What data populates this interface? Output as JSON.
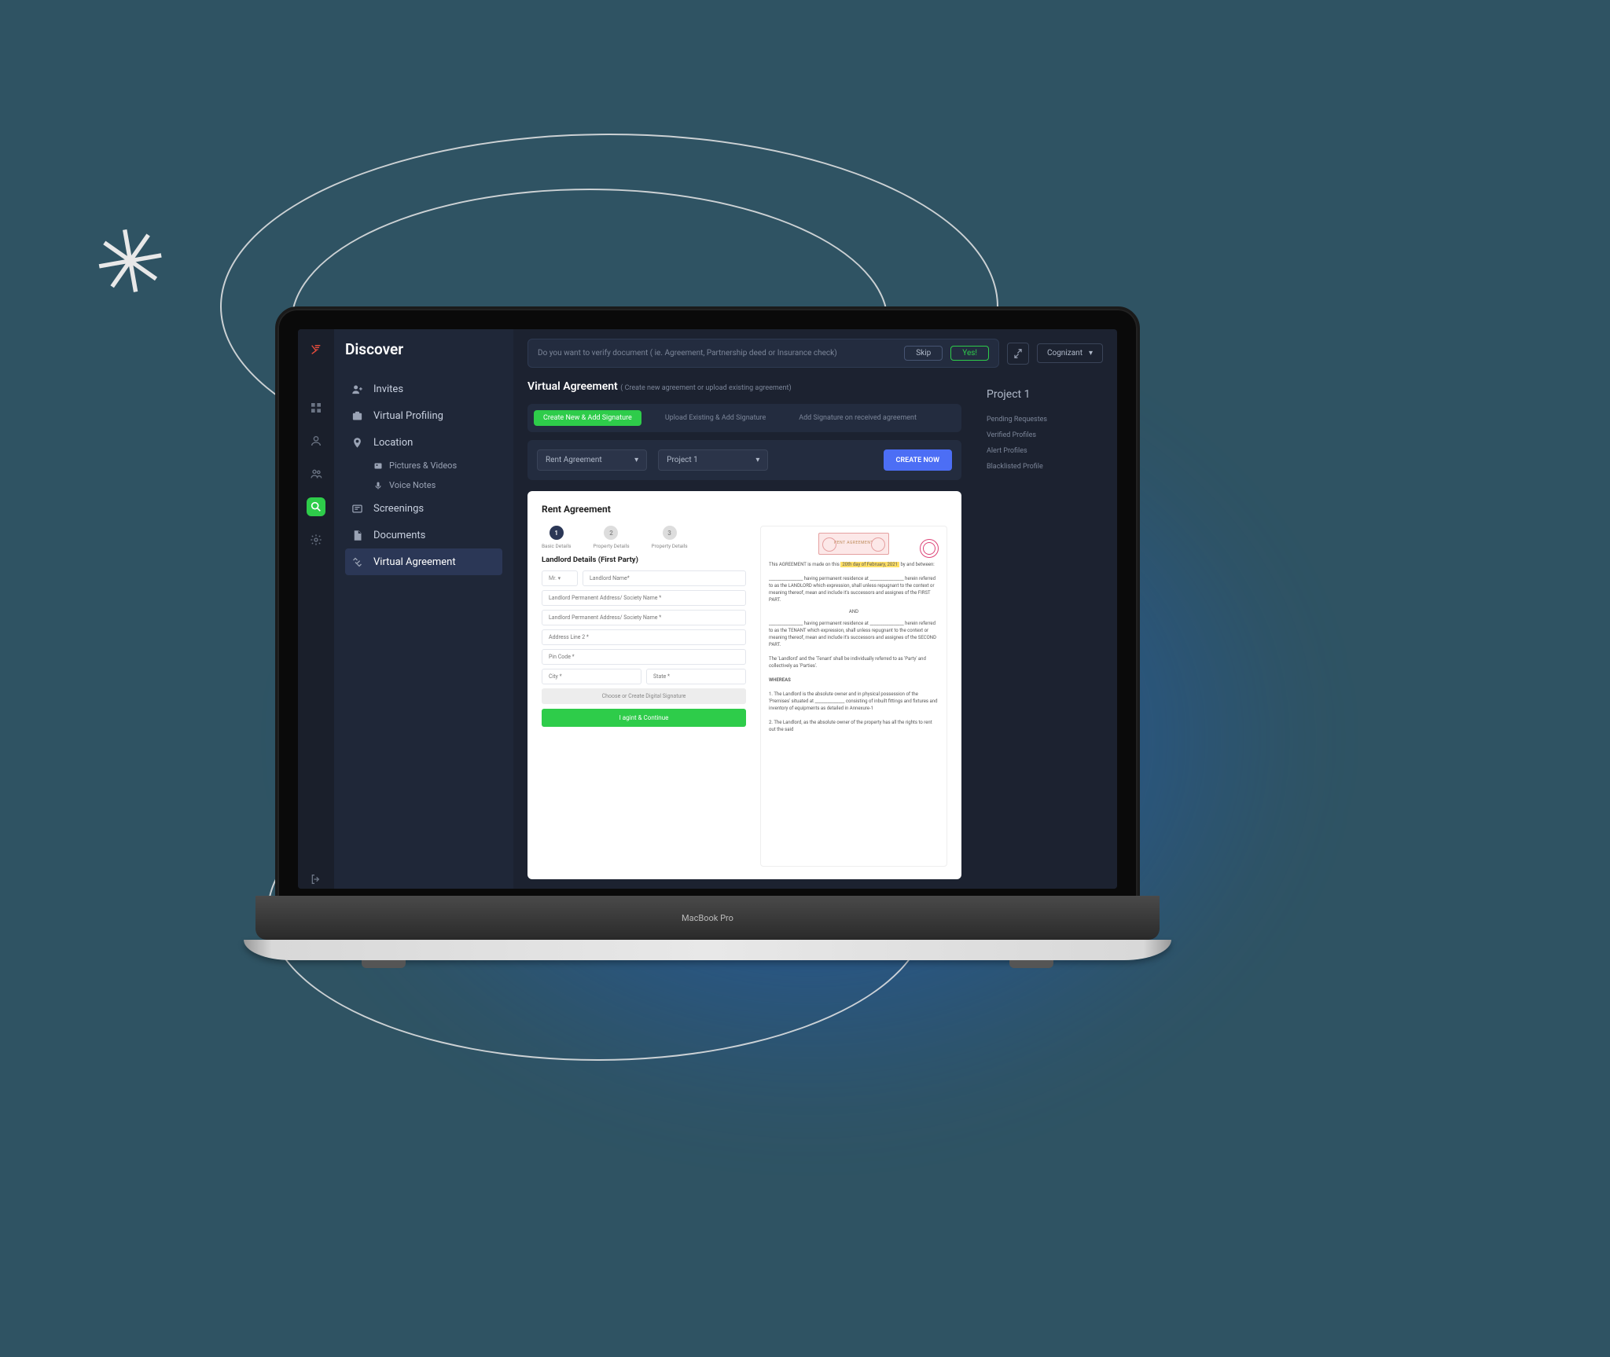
{
  "laptop_label": "MacBook Pro",
  "nav": {
    "title": "Discover",
    "items": [
      "Invites",
      "Virtual Profiling",
      "Location",
      "Pictures & Videos",
      "Voice Notes",
      "Screenings",
      "Documents",
      "Virtual Agreement"
    ]
  },
  "topbar": {
    "prompt": "Do you want to verify document ( ie. Agreement, Partnership deed or Insurance check)",
    "skip": "Skip",
    "yes": "Yes!",
    "account": "Cognizant"
  },
  "page": {
    "title": "Virtual Agreement",
    "subtitle": "( Create new agreement or upload existing agreement)"
  },
  "tabs": [
    "Create New & Add Signature",
    "Upload Existing & Add Signature",
    "Add Signature on received agreement"
  ],
  "controls": {
    "type": "Rent Agreement",
    "project": "Project 1",
    "create": "CREATE NOW"
  },
  "card": {
    "title": "Rent Agreement",
    "steps": [
      "Basic Details",
      "Property Details",
      "Property Details"
    ],
    "section": "Landlord Details (First Party)",
    "fields": {
      "prefix": "Mr.",
      "name": "Landlord Name*",
      "addr1": "Landlord Permanent Address/ Society Name *",
      "addr2": "Landlord Permanent Address/ Society Name *",
      "addr3": "Address Line 2 *",
      "pin": "Pin Code *",
      "city": "City *",
      "state": "State *"
    },
    "sig": "Choose or Create Digital Signature",
    "continue": "I agint & Continue",
    "doc": {
      "stamp": "RENT AGREEMENT",
      "intro_a": "This AGREEMENT is made on this ",
      "intro_hl": "20th day of February, 2021",
      "intro_b": " by and between:",
      "p1": "________________ having permanent residence at ________________ herein referred to as the LANDLORD which expression, shall unless repugnant to the context or meaning thereof, mean and include it's successors and assignes of the FIRST PART.",
      "and": "AND",
      "p2": "________________ having permanent residence at ________________ herein referred to as the TENANT which expression, shall unless repugnant to the context or meaning thereof, mean and include it's successors and assignes of the SECOND PART.",
      "p3": "The 'Landlord' and the 'Tenant' shall be individually referred to as 'Party' and collectively as 'Parties'.",
      "whereas": "WHEREAS",
      "c1": "1. The Landlord is the absolute owner and in physical possession of the 'Premises' situated at ______________ consisting of inbuilt fittings and fixtures and inventory of equipments as detailed in Annexure-1",
      "c2": "2. The Landlord, as the absolute owner of the property has all the rights to rent out the said"
    }
  },
  "right": {
    "title": "Project 1",
    "items": [
      "Pending Requestes",
      "Verified Profiles",
      "Alert Profiles",
      "Blacklisted Profile"
    ]
  }
}
